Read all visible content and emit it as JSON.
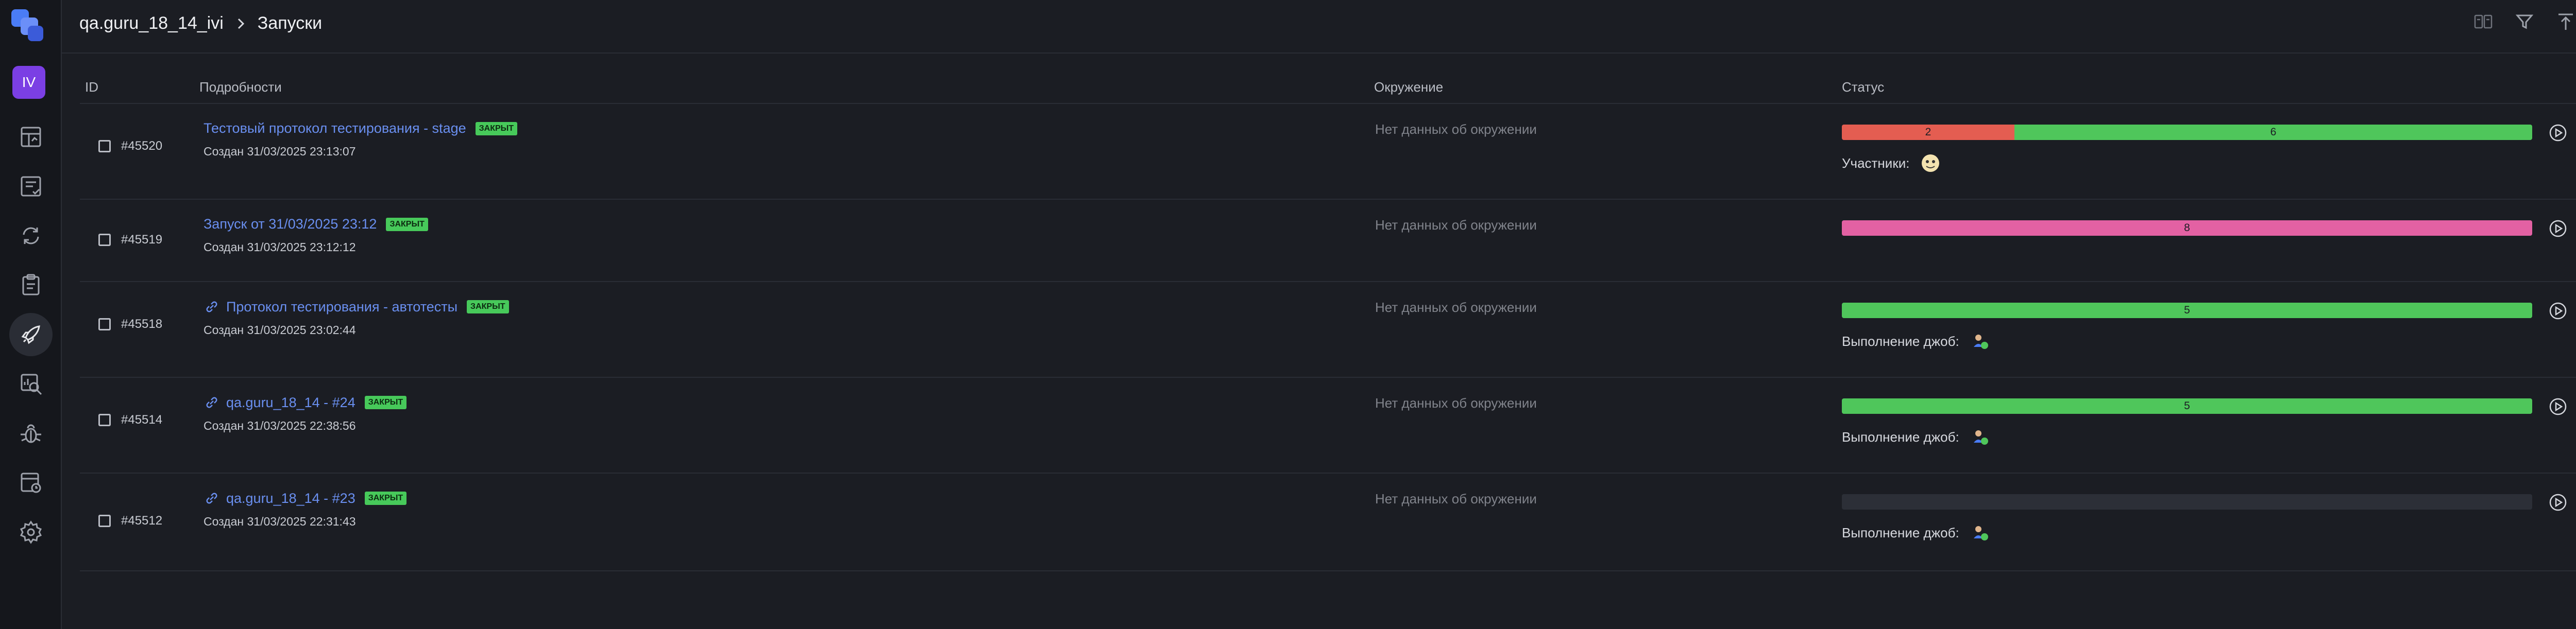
{
  "sidebar": {
    "avatar_initials": "IV",
    "items": [
      {
        "icon": "dashboard-icon"
      },
      {
        "icon": "test-cases-icon"
      },
      {
        "icon": "sync-icon"
      },
      {
        "icon": "clipboard-icon"
      },
      {
        "icon": "rocket-icon",
        "active": true
      },
      {
        "icon": "analytics-icon"
      },
      {
        "icon": "bug-icon"
      },
      {
        "icon": "jobs-icon"
      },
      {
        "icon": "settings-icon"
      }
    ]
  },
  "header": {
    "project": "qa.guru_18_14_ivi",
    "page": "Запуски",
    "tools": [
      "compare-icon",
      "filter-icon",
      "collapse-up-icon"
    ]
  },
  "table": {
    "columns": {
      "id": "ID",
      "details": "Подробности",
      "environment": "Окружение",
      "status": "Статус"
    },
    "rows": [
      {
        "id": "#45520",
        "title": "Тестовый протокол тестирования - stage",
        "badge": "ЗАКРЫТ",
        "created": "Создан 31/03/2025 23:13:07",
        "environment": "Нет данных об окружении",
        "linked": false,
        "segments": [
          {
            "type": "failed",
            "label": "2",
            "value": 2
          },
          {
            "type": "passed",
            "label": "6",
            "value": 6
          }
        ],
        "member_label": "Участники:"
      },
      {
        "id": "#45519",
        "title": "Запуск от 31/03/2025 23:12",
        "badge": "ЗАКРЫТ",
        "created": "Создан 31/03/2025 23:12:12",
        "environment": "Нет данных об окружении",
        "linked": false,
        "segments": [
          {
            "type": "broken",
            "label": "8",
            "value": 8
          }
        ],
        "member_label": ""
      },
      {
        "id": "#45518",
        "title": "Протокол тестирования - автотесты",
        "badge": "ЗАКРЫТ",
        "created": "Создан 31/03/2025 23:02:44",
        "environment": "Нет данных об окружении",
        "linked": true,
        "segments": [
          {
            "type": "passed",
            "label": "5",
            "value": 5
          }
        ],
        "member_label": "Выполнение джоб:"
      },
      {
        "id": "#45514",
        "title": "qa.guru_18_14 - #24",
        "badge": "ЗАКРЫТ",
        "created": "Создан 31/03/2025 22:38:56",
        "environment": "Нет данных об окружении",
        "linked": true,
        "segments": [
          {
            "type": "passed",
            "label": "5",
            "value": 5
          }
        ],
        "member_label": "Выполнение джоб:"
      },
      {
        "id": "#45512",
        "title": "qa.guru_18_14 - #23",
        "badge": "ЗАКРЫТ",
        "created": "Создан 31/03/2025 22:31:43",
        "environment": "Нет данных об окружении",
        "linked": true,
        "segments": [],
        "member_label": "Выполнение джоб:"
      }
    ]
  },
  "colors": {
    "failed": "#e45d51",
    "passed": "#4fc65b",
    "broken": "#e361a3",
    "link": "#6a8ff0",
    "accent": "#7b3fe4"
  }
}
